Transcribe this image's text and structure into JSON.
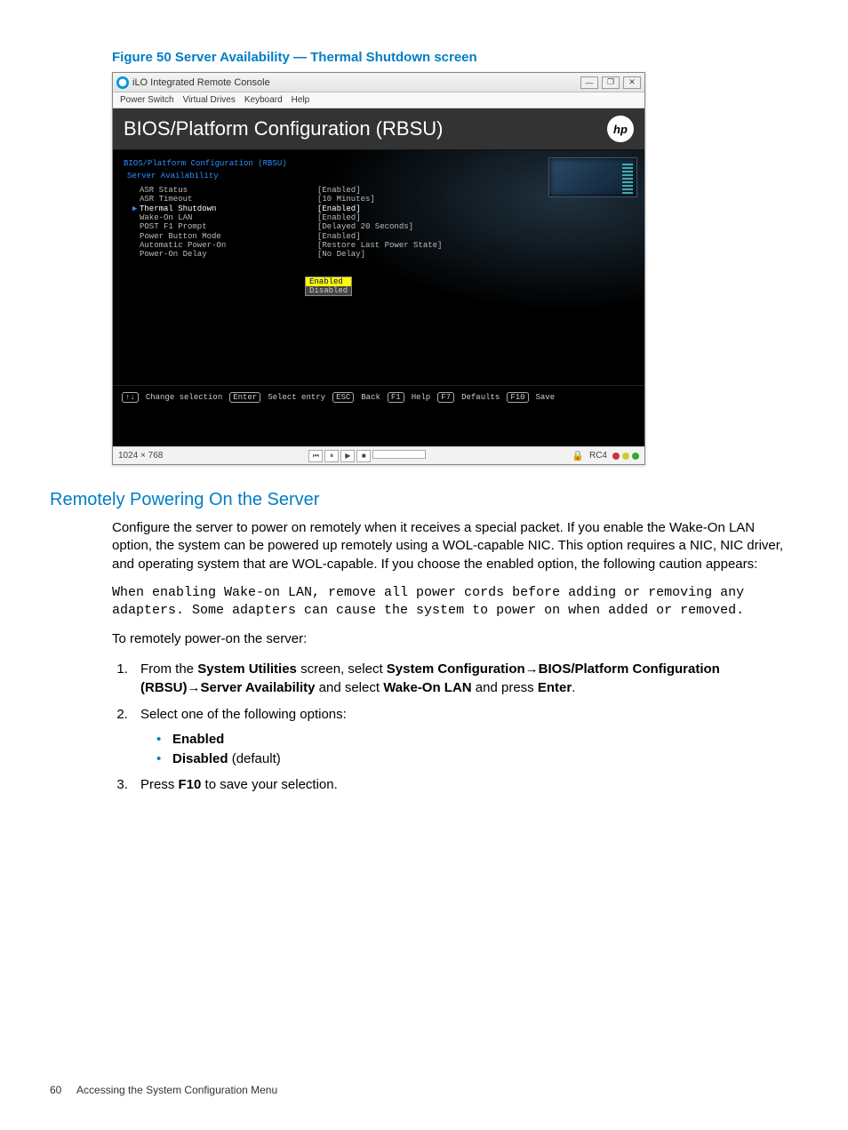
{
  "figure": {
    "caption": "Figure 50 Server Availability — Thermal Shutdown screen"
  },
  "window": {
    "title": "iLO Integrated Remote Console",
    "min_glyph": "—",
    "max_glyph": "❐",
    "close_glyph": "✕"
  },
  "menubar": {
    "items": [
      "Power Switch",
      "Virtual Drives",
      "Keyboard",
      "Help"
    ]
  },
  "bios": {
    "header": "BIOS/Platform Configuration (RBSU)",
    "logo_text": "hp",
    "breadcrumb": "BIOS/Platform Configuration (RBSU)",
    "section": "Server Availability",
    "settings": [
      {
        "label": "ASR Status",
        "value": "[Enabled]",
        "selected": false
      },
      {
        "label": "ASR Timeout",
        "value": "[10 Minutes]",
        "selected": false
      },
      {
        "label": "Thermal Shutdown",
        "value": "[Enabled]",
        "selected": true
      },
      {
        "label": "Wake-On LAN",
        "value": "[Enabled]",
        "selected": false
      },
      {
        "label": "POST F1 Prompt",
        "value": "[Delayed 20 Seconds]",
        "selected": false
      },
      {
        "label": "Power Button Mode",
        "value": "[Enabled]",
        "selected": false
      },
      {
        "label": "Automatic Power-On",
        "value": "[Restore Last Power State]",
        "selected": false
      },
      {
        "label": "Power-On Delay",
        "value": "[No Delay]",
        "selected": false
      }
    ],
    "popup": {
      "options": [
        "Enabled",
        "Disabled"
      ],
      "selected_index": 0
    },
    "keybar": [
      {
        "key": "↑↓",
        "label": "Change selection"
      },
      {
        "key": "Enter",
        "label": "Select entry"
      },
      {
        "key": "ESC",
        "label": "Back"
      },
      {
        "key": "F1",
        "label": "Help"
      },
      {
        "key": "F7",
        "label": "Defaults"
      },
      {
        "key": "F10",
        "label": "Save"
      }
    ]
  },
  "status": {
    "resolution": "1024 × 768",
    "encryption": "RC4"
  },
  "section": {
    "heading": "Remotely Powering On the Server",
    "intro": "Configure the server to power on remotely when it receives a special packet. If you enable the Wake-On LAN option, the system can be powered up remotely using a WOL-capable NIC. This option requires a NIC, NIC driver, and operating system that are WOL-capable. If you choose the enabled option, the following caution appears:",
    "caution": "When enabling Wake-on LAN, remove all power cords before adding or removing any adapters. Some adapters can cause the system to power on when added or removed.",
    "lead": "To remotely power-on the server:",
    "step1_a": "From the ",
    "step1_b": "System Utilities",
    "step1_c": " screen, select ",
    "step1_d": "System Configuration",
    "step1_e": "BIOS/Platform Configuration (RBSU)",
    "step1_f": "Server Availability",
    "step1_g": " and select ",
    "step1_h": "Wake-On LAN",
    "step1_i": " and press ",
    "step1_j": "Enter",
    "arrow": "→",
    "period": ".",
    "step2": "Select one of the following options:",
    "opt_enabled": "Enabled",
    "opt_disabled": "Disabled",
    "opt_disabled_suffix": " (default)",
    "step3_a": "Press ",
    "step3_b": "F10",
    "step3_c": " to save your selection."
  },
  "footer": {
    "page_number": "60",
    "running": "Accessing the System Configuration Menu"
  }
}
